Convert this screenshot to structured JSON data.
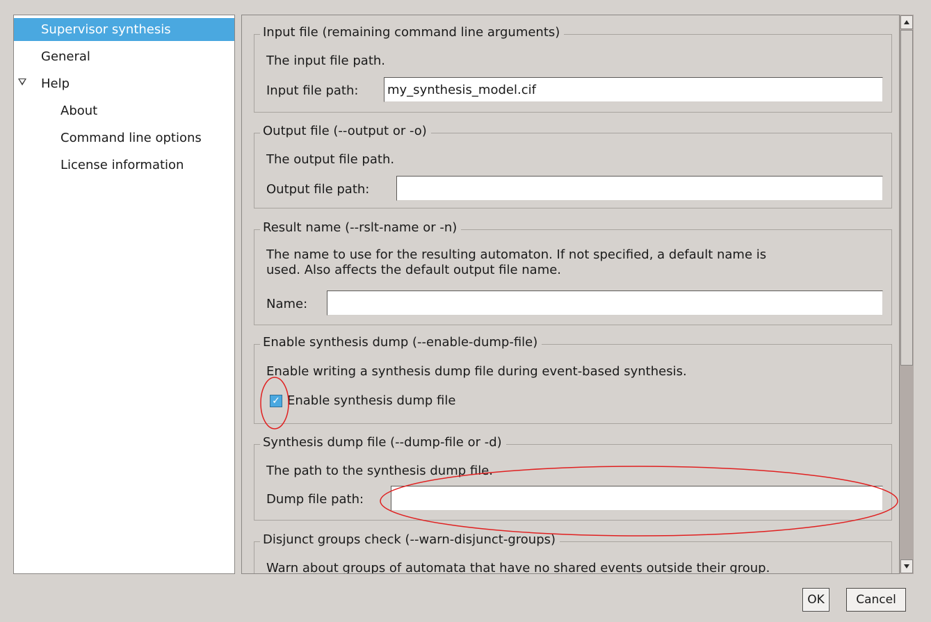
{
  "tree": {
    "items": [
      {
        "label": "Supervisor synthesis",
        "selected": true
      },
      {
        "label": "General"
      },
      {
        "label": "Help",
        "expanded": true
      },
      {
        "label": "About"
      },
      {
        "label": "Command line options"
      },
      {
        "label": "License information"
      }
    ]
  },
  "sections": {
    "input_file": {
      "title": "Input file (remaining command line arguments)",
      "description": "The input file path.",
      "field_label": "Input file path:",
      "value": "my_synthesis_model.cif"
    },
    "output_file": {
      "title": "Output file (--output or -o)",
      "description": "The output file path.",
      "field_label": "Output file path:",
      "value": ""
    },
    "result_name": {
      "title": "Result name (--rslt-name or -n)",
      "description_line1": "The name to use for the resulting automaton. If not specified, a default name is",
      "description_line2": "used. Also affects the default output file name.",
      "field_label": "Name:",
      "value": ""
    },
    "synthesis_dump": {
      "title": "Enable synthesis dump (--enable-dump-file)",
      "description": "Enable writing a synthesis dump file during event-based synthesis.",
      "checkbox_label": "Enable synthesis dump file",
      "checked": true
    },
    "dump_file": {
      "title": "Synthesis dump file (--dump-file or -d)",
      "description": "The path to the synthesis dump file.",
      "field_label": "Dump file path:",
      "value": ""
    },
    "disjunct_groups": {
      "title": "Disjunct groups check (--warn-disjunct-groups)",
      "description": "Warn about groups of automata that have no shared events outside their group."
    }
  },
  "buttons": {
    "ok": "OK",
    "cancel": "Cancel"
  },
  "colors": {
    "selection": "#4aa8e0",
    "annotation": "#e02020",
    "background": "#d6d2ce"
  }
}
